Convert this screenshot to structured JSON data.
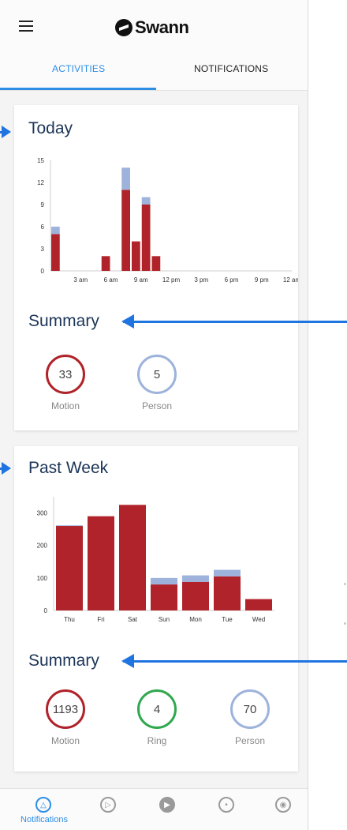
{
  "app": {
    "logo_text": "Swann"
  },
  "tabs": [
    {
      "label": "ACTIVITIES",
      "active": true
    },
    {
      "label": "NOTIFICATIONS",
      "active": false
    }
  ],
  "today": {
    "title": "Today",
    "summary_title": "Summary",
    "chart_data": {
      "type": "bar",
      "stacked": true,
      "x_tick_labels": [
        "3 am",
        "6 am",
        "9 am",
        "12 pm",
        "3 pm",
        "6 pm",
        "9 pm",
        "12 am"
      ],
      "y_ticks": [
        0,
        3,
        6,
        9,
        12,
        15
      ],
      "ylim": [
        0,
        15
      ],
      "hours": [
        0,
        1,
        2,
        3,
        4,
        5,
        6,
        7,
        8,
        9,
        10,
        11,
        12,
        13,
        14,
        15,
        16,
        17,
        18,
        19,
        20,
        21,
        22,
        23
      ],
      "series": [
        {
          "name": "Motion",
          "color": "#b0232a",
          "values": [
            5,
            0,
            0,
            0,
            0,
            2,
            0,
            11,
            4,
            9,
            2,
            0,
            0,
            0,
            0,
            0,
            0,
            0,
            0,
            0,
            0,
            0,
            0,
            0
          ]
        },
        {
          "name": "Person",
          "color": "#9db3dc",
          "values": [
            1,
            0,
            0,
            0,
            0,
            0,
            0,
            3,
            0,
            1,
            0,
            0,
            0,
            0,
            0,
            0,
            0,
            0,
            0,
            0,
            0,
            0,
            0,
            0
          ]
        }
      ]
    },
    "stats": [
      {
        "value": "33",
        "label": "Motion",
        "color": "#b0232a"
      },
      {
        "value": "5",
        "label": "Person",
        "color": "#9db3dc"
      }
    ]
  },
  "past_week": {
    "title": "Past Week",
    "summary_title": "Summary",
    "chart_data": {
      "type": "bar",
      "stacked": true,
      "categories": [
        "Thu",
        "Fri",
        "Sat",
        "Sun",
        "Mon",
        "Tue",
        "Wed"
      ],
      "y_ticks": [
        0,
        100,
        200,
        300
      ],
      "ylim": [
        0,
        350
      ],
      "series": [
        {
          "name": "Motion",
          "color": "#b0232a",
          "values": [
            260,
            290,
            325,
            80,
            88,
            105,
            35
          ]
        },
        {
          "name": "Person",
          "color": "#9db3dc",
          "values": [
            2,
            0,
            0,
            20,
            20,
            20,
            0
          ]
        }
      ]
    },
    "stats": [
      {
        "value": "1193",
        "label": "Motion",
        "color": "#b0232a"
      },
      {
        "value": "4",
        "label": "Ring",
        "color": "#2fa84f"
      },
      {
        "value": "70",
        "label": "Person",
        "color": "#9db3dc"
      }
    ]
  },
  "bottom_nav": [
    {
      "name": "notifications",
      "label": "Notifications",
      "active": true,
      "icon": "bell-icon"
    },
    {
      "name": "playback",
      "active": false,
      "icon": "playback-icon"
    },
    {
      "name": "live",
      "active": false,
      "icon": "play-icon"
    },
    {
      "name": "devices",
      "active": false,
      "icon": "devices-icon"
    },
    {
      "name": "settings",
      "active": false,
      "icon": "settings-icon"
    }
  ]
}
